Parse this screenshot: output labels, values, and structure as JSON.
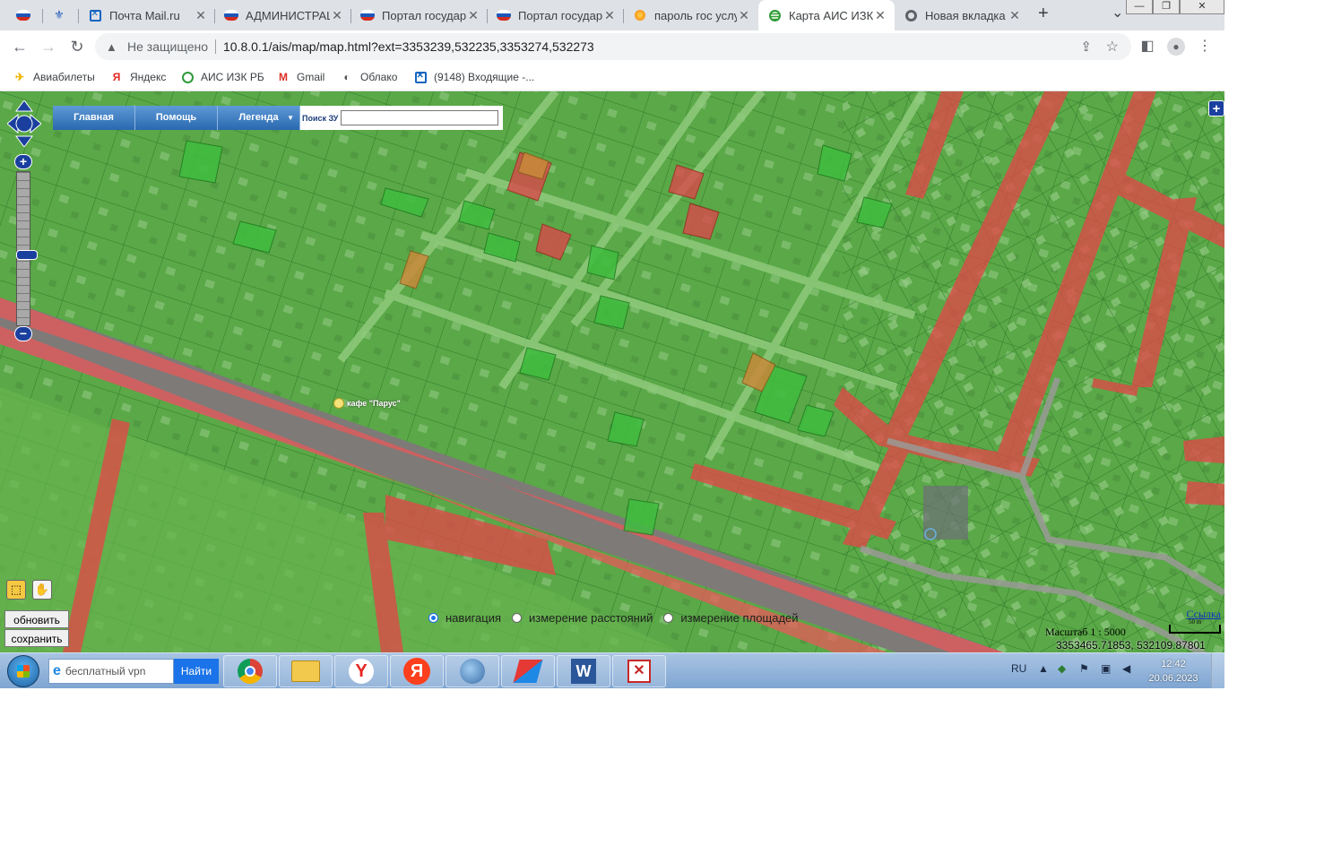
{
  "browser": {
    "tabs": [
      {
        "title": "",
        "icon": "flag-icon"
      },
      {
        "title": "",
        "icon": "emblem-icon"
      },
      {
        "title": "Почта Mail.ru",
        "icon": "mail-icon"
      },
      {
        "title": "АДМИНИСТРАЦИ",
        "icon": "flag-icon"
      },
      {
        "title": "Портал государ",
        "icon": "flag-icon"
      },
      {
        "title": "Портал государ",
        "icon": "flag-icon"
      },
      {
        "title": "пароль гос услу",
        "icon": "flame-icon"
      },
      {
        "title": "Карта АИС ИЗК",
        "icon": "globe-icon",
        "active": true
      },
      {
        "title": "Новая вкладка",
        "icon": "chrome-icon"
      }
    ],
    "new_tab": "+",
    "tab_menu": "⌄",
    "window_controls": [
      "—",
      "❐",
      "✕"
    ],
    "address": {
      "security_label": "Не защищено",
      "url": "10.8.0.1/ais/map/map.html?ext=3353239,532235,3353274,532273"
    },
    "bookmarks": [
      {
        "label": "Авиабилеты",
        "icon": "plane-icon"
      },
      {
        "label": "Яндекс",
        "icon": "yandex-icon"
      },
      {
        "label": "АИС ИЗК РБ",
        "icon": "globe-icon"
      },
      {
        "label": "Gmail",
        "icon": "gmail-icon"
      },
      {
        "label": "Облако",
        "icon": "cloud-icon"
      },
      {
        "label": "(9148) Входящие -...",
        "icon": "mail-icon"
      }
    ]
  },
  "map": {
    "menu": {
      "home": "Главная",
      "help": "Помощь",
      "legend": "Легенда",
      "legend_arrow": "▼"
    },
    "search": {
      "label": "Поиск ЗУ",
      "value": ""
    },
    "zoom_in": "+",
    "zoom_out": "−",
    "expand": "+",
    "poi_label": "кафе \"Парус\"",
    "actions": {
      "refresh": "обновить",
      "save": "сохранить"
    },
    "modes": [
      {
        "label": "навигация",
        "selected": true
      },
      {
        "label": "измерение расстояний",
        "selected": false
      },
      {
        "label": "измерение площадей",
        "selected": false
      }
    ],
    "link": "Ссылка",
    "scale": "Масштаб 1 : 5000",
    "scale_bar": "50 m",
    "coords": "3353465.71853, 532109.87801",
    "colors": {
      "parcel_green": "#3fbd3f",
      "road_red": "#e04848",
      "undeveloped_orange": "#c88a3a"
    }
  },
  "taskbar": {
    "search_placeholder": "бесплатный vpn",
    "search_button": "Найти",
    "apps": [
      "chrome-icon",
      "explorer-icon",
      "yandex-browser-icon",
      "yandex-icon",
      "earth-pro-icon",
      "anydesk-icon",
      "word-icon",
      "pdf-icon"
    ],
    "lang": "RU",
    "time": "12:42",
    "date": "20.06.2023"
  }
}
